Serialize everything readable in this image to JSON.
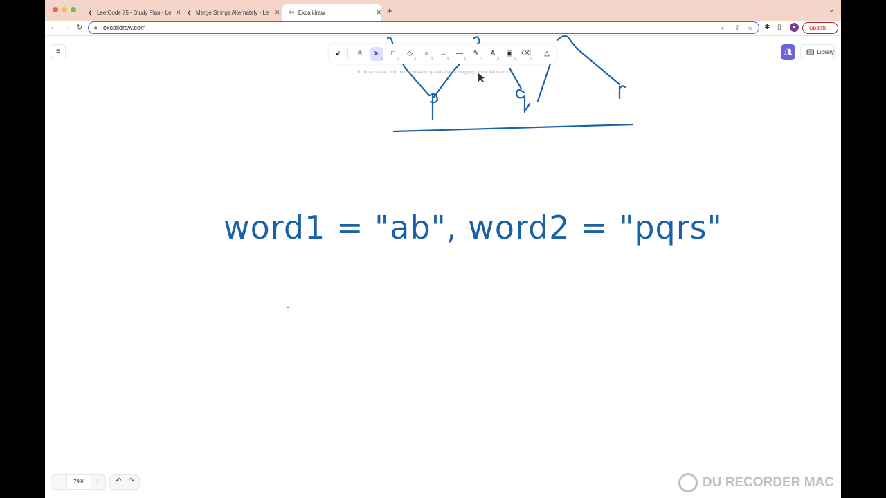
{
  "browser": {
    "tabs": [
      {
        "title": "LeetCode 75 - Study Plan - Le",
        "favicon": "leetcode-icon",
        "active": false
      },
      {
        "title": "Merge Strings Alternately - Le",
        "favicon": "leetcode-icon",
        "active": false
      },
      {
        "title": "Excalidraw",
        "favicon": "excalidraw-icon",
        "active": true
      }
    ],
    "new_tab": "+",
    "url": "excalidraw.com",
    "update_label": "Update"
  },
  "excalidraw": {
    "tools": [
      {
        "name": "lock",
        "key": ""
      },
      {
        "name": "hand",
        "key": ""
      },
      {
        "name": "selection",
        "key": "1",
        "active": true
      },
      {
        "name": "rectangle",
        "key": "2"
      },
      {
        "name": "diamond",
        "key": "3"
      },
      {
        "name": "ellipse",
        "key": "4"
      },
      {
        "name": "arrow",
        "key": "5"
      },
      {
        "name": "line",
        "key": "6"
      },
      {
        "name": "draw",
        "key": "7"
      },
      {
        "name": "text",
        "key": "8"
      },
      {
        "name": "image",
        "key": "9"
      },
      {
        "name": "eraser",
        "key": "0"
      },
      {
        "name": "extra-tools",
        "key": ""
      }
    ],
    "hint": "To move canvas, hold mouse wheel or spacebar while dragging, or use the hand tool",
    "library_label": "Library",
    "zoom_level": "79%",
    "canvas_text": "word1 = \"ab\", word2 = \"pqrs\"",
    "tree_letters": [
      "p",
      "q",
      "r"
    ],
    "accent_color": "#6965db",
    "ink_color": "#1a62a8"
  },
  "watermark": "DU RECORDER MAC"
}
